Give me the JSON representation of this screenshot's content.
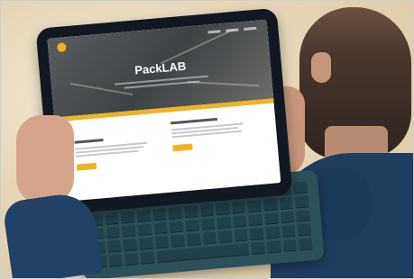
{
  "photo": {
    "screen": {
      "title": "PackLAB",
      "accent_color": "#f0b323",
      "hero_color": "#4a4d50"
    },
    "keyboard_color": "#2d4f58",
    "shirt_color": "#1f3d5e"
  }
}
